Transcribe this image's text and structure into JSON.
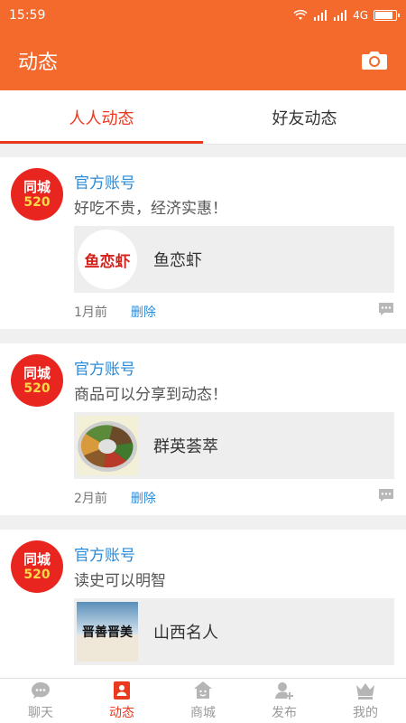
{
  "status_bar": {
    "time": "15:59",
    "network": "4G",
    "battery_level": 0.8
  },
  "app_bar": {
    "title": "动态",
    "camera_icon": "camera-icon"
  },
  "tabs": [
    {
      "label": "人人动态",
      "active": true
    },
    {
      "label": "好友动态",
      "active": false
    }
  ],
  "posts": [
    {
      "avatar_line1": "同城",
      "avatar_line2": "520",
      "author": "官方账号",
      "content": "好吃不贵，经济实惠！",
      "shared_title": "鱼恋虾",
      "thumb_text": "鱼恋虾",
      "time": "1月前",
      "delete_label": "删除"
    },
    {
      "avatar_line1": "同城",
      "avatar_line2": "520",
      "author": "官方账号",
      "content": "商品可以分享到动态！",
      "shared_title": "群英荟萃",
      "time": "2月前",
      "delete_label": "删除"
    },
    {
      "avatar_line1": "同城",
      "avatar_line2": "520",
      "author": "官方账号",
      "content": "读史可以明智",
      "shared_title": "山西名人",
      "thumb_text": "晋善晋美"
    }
  ],
  "bottom_nav": [
    {
      "label": "聊天",
      "icon": "chat-icon",
      "active": false
    },
    {
      "label": "动态",
      "icon": "contacts-icon",
      "active": true
    },
    {
      "label": "商城",
      "icon": "store-icon",
      "active": false
    },
    {
      "label": "发布",
      "icon": "publish-icon",
      "active": false
    },
    {
      "label": "我的",
      "icon": "crown-icon",
      "active": false
    }
  ],
  "colors": {
    "primary": "#f46a2c",
    "accent": "#e9391f",
    "link": "#2a8bd8"
  }
}
